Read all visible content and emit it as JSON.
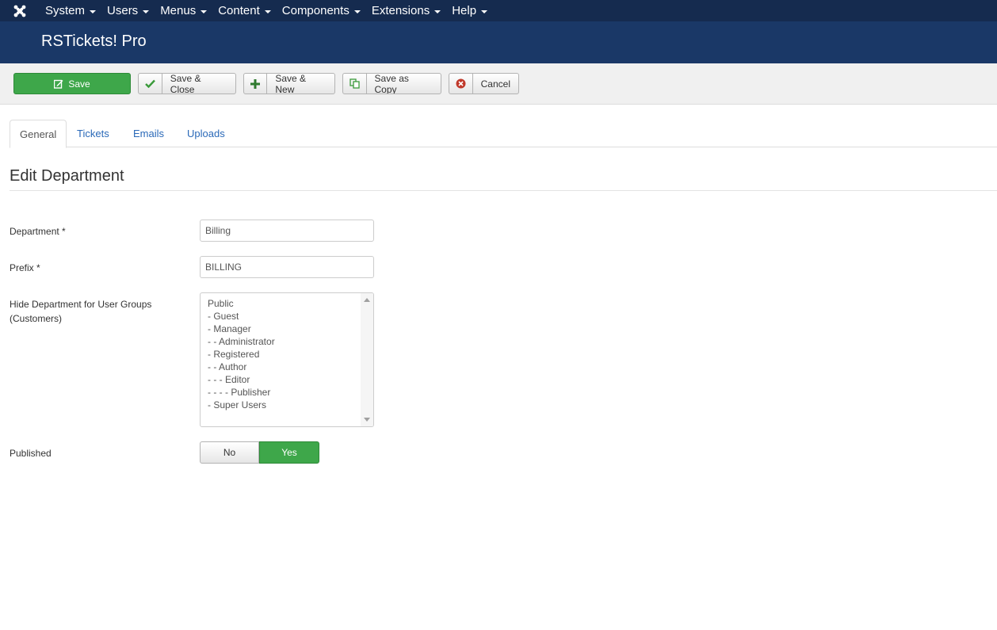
{
  "colors": {
    "topnav_bg": "#152b4f",
    "titlebar_bg": "#1a3867",
    "success_green": "#3ea74a",
    "link_blue": "#2a69b8"
  },
  "topnav": {
    "logo_icon": "joomla-logo-icon",
    "menu": [
      {
        "label": "System"
      },
      {
        "label": "Users"
      },
      {
        "label": "Menus"
      },
      {
        "label": "Content"
      },
      {
        "label": "Components"
      },
      {
        "label": "Extensions"
      },
      {
        "label": "Help"
      }
    ]
  },
  "titlebar": {
    "title": "RSTickets! Pro"
  },
  "toolbar": {
    "save_label": "Save",
    "save_close_label": "Save & Close",
    "save_new_label": "Save & New",
    "save_copy_label": "Save as Copy",
    "cancel_label": "Cancel"
  },
  "tabs": [
    {
      "label": "General",
      "active": true
    },
    {
      "label": "Tickets",
      "active": false
    },
    {
      "label": "Emails",
      "active": false
    },
    {
      "label": "Uploads",
      "active": false
    }
  ],
  "page": {
    "title": "Edit Department"
  },
  "form": {
    "department": {
      "label": "Department *",
      "value": "Billing"
    },
    "prefix": {
      "label": "Prefix *",
      "value": "BILLING"
    },
    "hide_groups": {
      "label_line1": "Hide Department for User Groups",
      "label_line2": "(Customers)",
      "options": [
        "Public",
        "- Guest",
        "- Manager",
        "- - Administrator",
        "- Registered",
        "- - Author",
        "- - - Editor",
        "- - - - Publisher",
        "- Super Users"
      ]
    },
    "published": {
      "label": "Published",
      "no_label": "No",
      "yes_label": "Yes",
      "selected": "Yes"
    }
  }
}
